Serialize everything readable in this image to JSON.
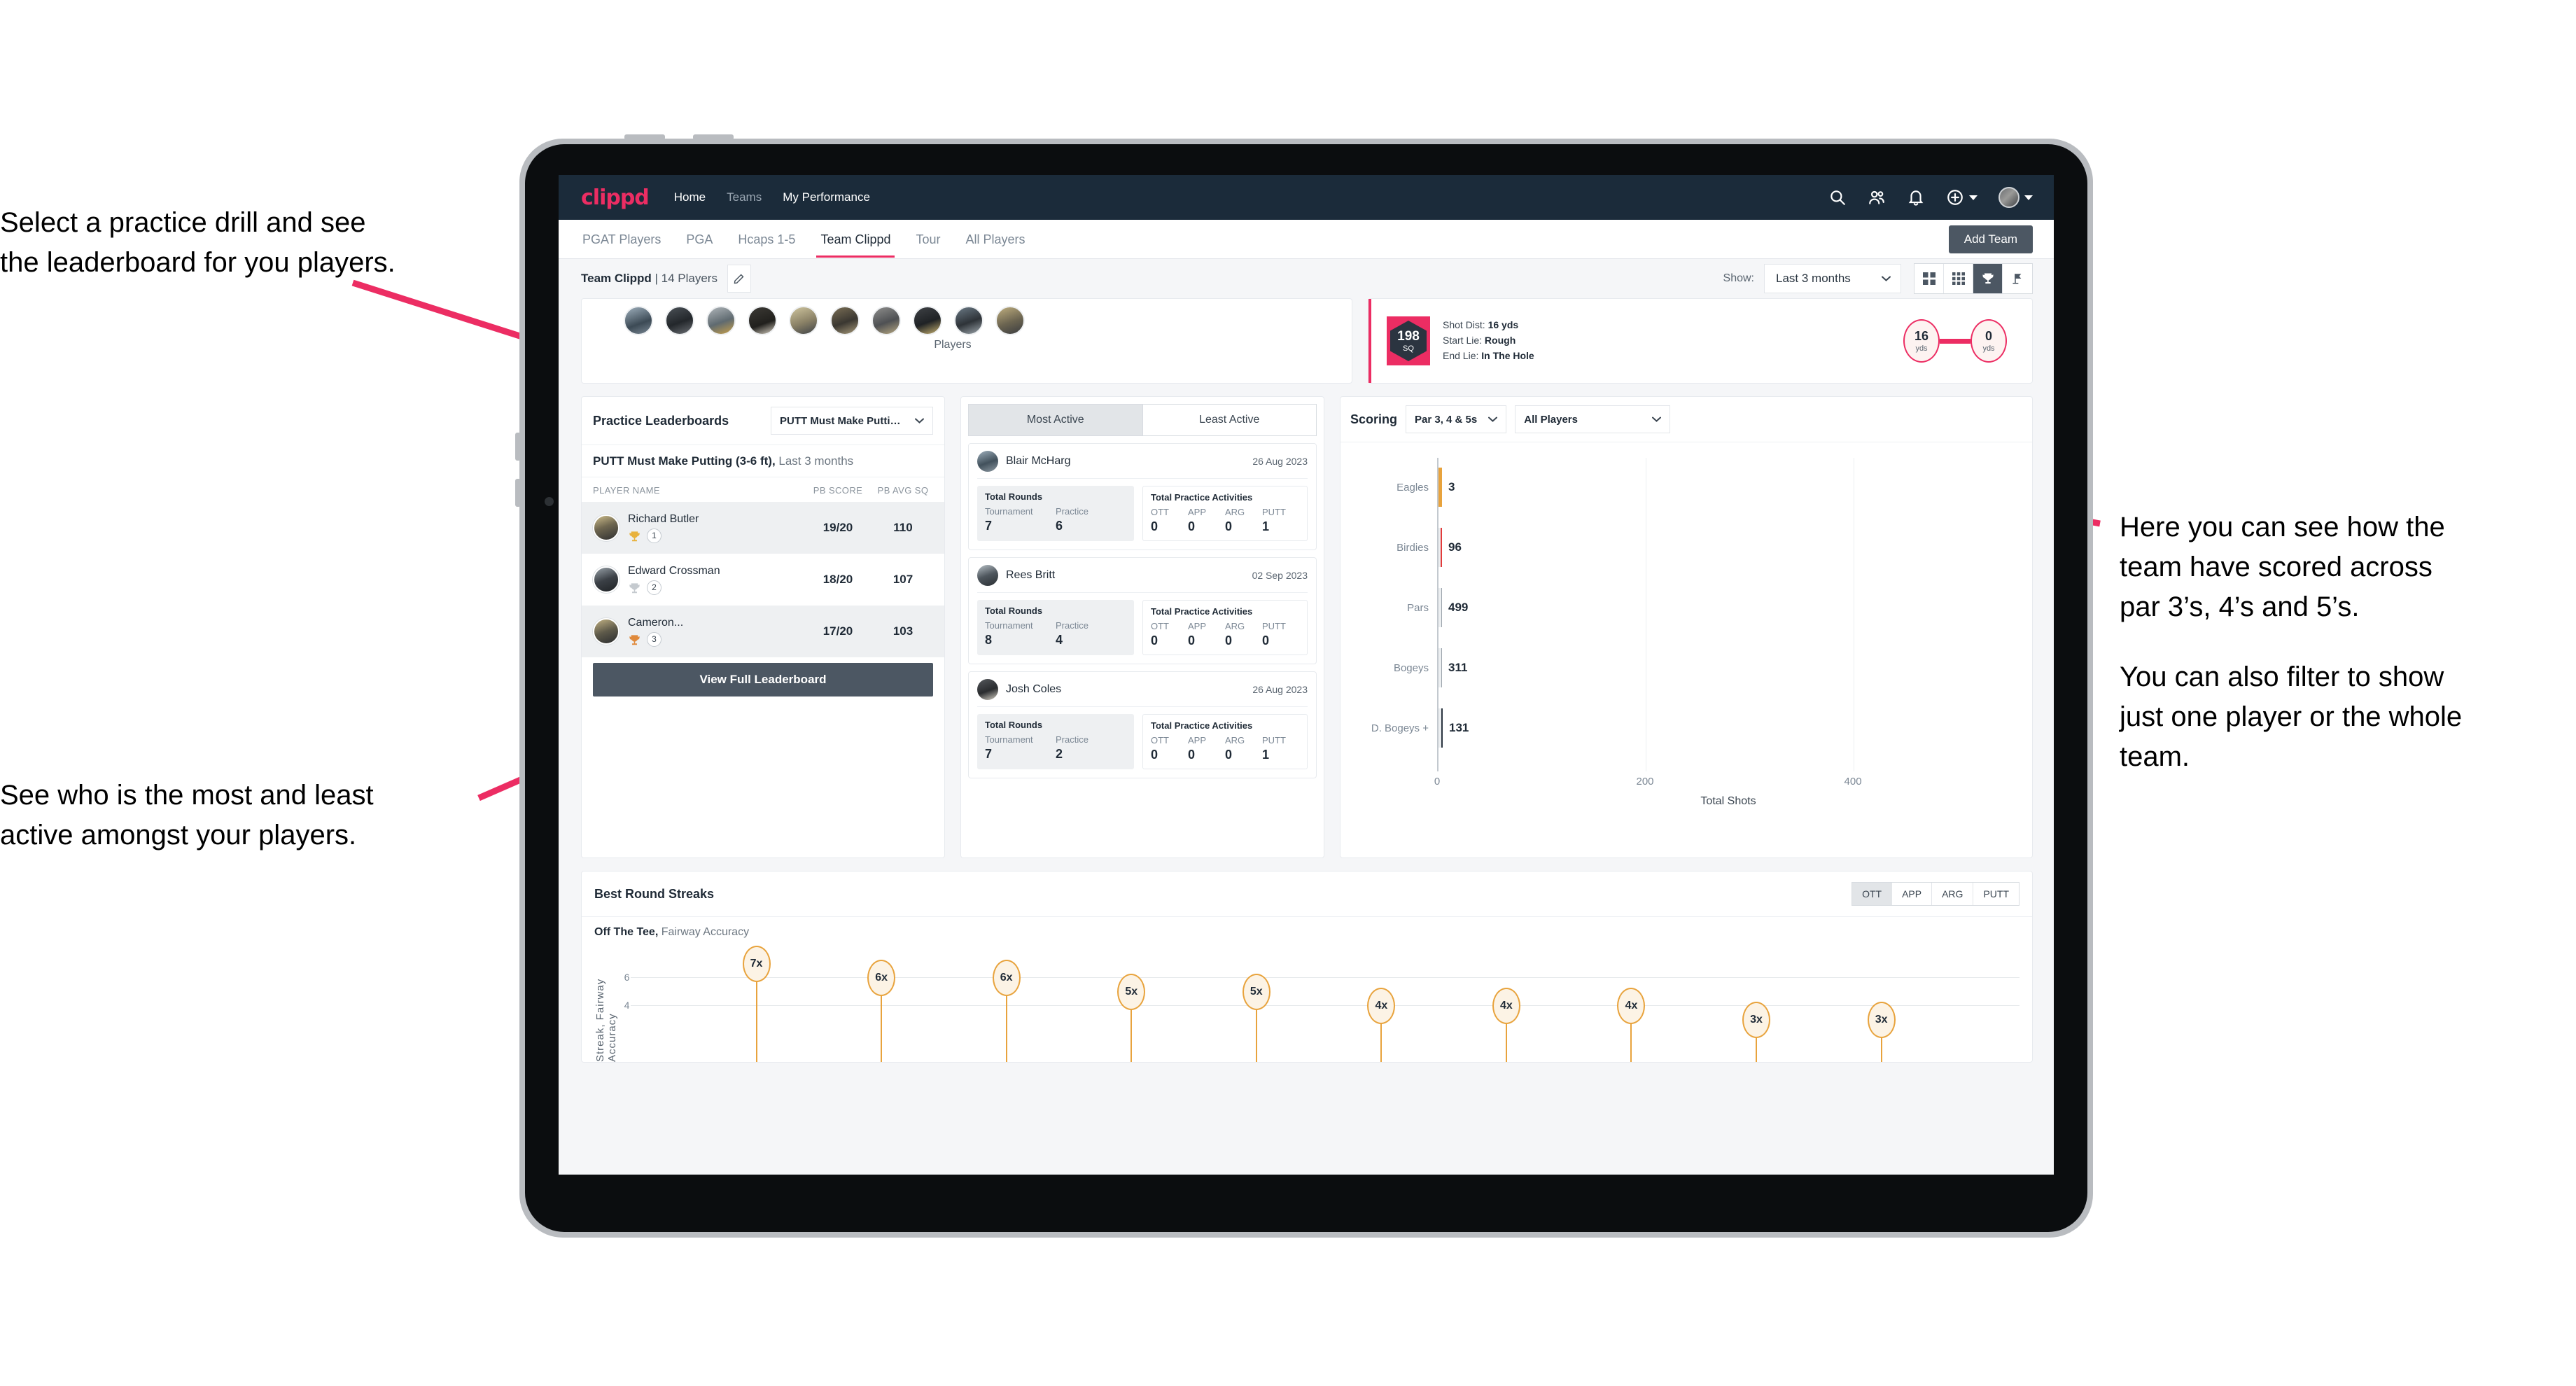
{
  "annotations": {
    "top_left": [
      "Select a practice drill and see",
      "the leaderboard for you players."
    ],
    "bottom_left": [
      "See who is the most and least",
      "active amongst your players."
    ],
    "right_p1": [
      "Here you can see how the",
      "team have scored across",
      "par 3’s, 4’s and 5’s."
    ],
    "right_p2": [
      "You can also filter to show",
      "just one player or the whole",
      "team."
    ]
  },
  "topnav": {
    "logo": "clippd",
    "links": [
      {
        "label": "Home",
        "dim": false
      },
      {
        "label": "Teams",
        "dim": true
      },
      {
        "label": "My Performance",
        "dim": false
      }
    ],
    "icons": [
      "search-icon",
      "people-icon",
      "bell-icon",
      "plus-circle-icon",
      "avatar"
    ]
  },
  "tabs": [
    {
      "label": "PGAT Players",
      "active": false
    },
    {
      "label": "PGA",
      "active": false
    },
    {
      "label": "Hcaps 1-5",
      "active": false
    },
    {
      "label": "Team Clippd",
      "active": true
    },
    {
      "label": "Tour",
      "active": false
    },
    {
      "label": "All Players",
      "active": false
    }
  ],
  "add_team_label": "Add Team",
  "toolbar": {
    "team_name": "Team Clippd",
    "team_players": "| 14 Players",
    "show_label": "Show:",
    "period_value": "Last 3 months",
    "view_toggles": [
      {
        "name": "grid-2x2-icon",
        "active": false
      },
      {
        "name": "grid-3x3-icon",
        "active": false
      },
      {
        "name": "trophy-icon",
        "active": true
      },
      {
        "name": "flag-icon",
        "active": false
      }
    ]
  },
  "players_card": {
    "caption": "Players",
    "avatar_count": 10
  },
  "shot_card": {
    "sq_value": "198",
    "sq_unit": "SQ",
    "lines": [
      {
        "key": "Shot Dist:",
        "value": "16 yds"
      },
      {
        "key": "Start Lie:",
        "value": "Rough"
      },
      {
        "key": "End Lie:",
        "value": "In The Hole"
      }
    ],
    "start_dist": "16",
    "start_unit": "yds",
    "end_dist": "0",
    "end_unit": "yds"
  },
  "leaderboard": {
    "title": "Practice Leaderboards",
    "drill_select": "PUTT Must Make Putting ...",
    "subtitle_bold": "PUTT Must Make Putting (3-6 ft),",
    "subtitle_light": " Last 3 months",
    "columns": [
      "PLAYER NAME",
      "PB SCORE",
      "PB AVG SQ"
    ],
    "rows": [
      {
        "name": "Richard Butler",
        "rank": "1",
        "medal": "gold",
        "pb_score": "19/20",
        "pb_avg_sq": "110"
      },
      {
        "name": "Edward Crossman",
        "rank": "2",
        "medal": "silver",
        "pb_score": "18/20",
        "pb_avg_sq": "107"
      },
      {
        "name": "Cameron...",
        "rank": "3",
        "medal": "bronze",
        "pb_score": "17/20",
        "pb_avg_sq": "103"
      }
    ],
    "button": "View Full Leaderboard"
  },
  "activity": {
    "tabs": [
      {
        "label": "Most Active",
        "active": true
      },
      {
        "label": "Least Active",
        "active": false
      }
    ],
    "rounds_title": "Total Rounds",
    "activities_title": "Total Practice Activities",
    "rounds_keys": [
      "Tournament",
      "Practice"
    ],
    "activity_keys": [
      "OTT",
      "APP",
      "ARG",
      "PUTT"
    ],
    "players": [
      {
        "name": "Blair McHarg",
        "date": "26 Aug 2023",
        "tournament": "7",
        "practice": "6",
        "ott": "0",
        "app": "0",
        "arg": "0",
        "putt": "1"
      },
      {
        "name": "Rees Britt",
        "date": "02 Sep 2023",
        "tournament": "8",
        "practice": "4",
        "ott": "0",
        "app": "0",
        "arg": "0",
        "putt": "0"
      },
      {
        "name": "Josh Coles",
        "date": "26 Aug 2023",
        "tournament": "7",
        "practice": "2",
        "ott": "0",
        "app": "0",
        "arg": "0",
        "putt": "1"
      }
    ]
  },
  "scoring": {
    "title": "Scoring",
    "par_filter": "Par 3, 4 & 5s",
    "player_filter": "All Players"
  },
  "streaks": {
    "title": "Best Round Streaks",
    "segments": [
      {
        "label": "OTT",
        "active": true
      },
      {
        "label": "APP",
        "active": false
      },
      {
        "label": "ARG",
        "active": false
      },
      {
        "label": "PUTT",
        "active": false
      }
    ],
    "sub_bold": "Off The Tee,",
    "sub_light": " Fairway Accuracy"
  },
  "chart_data": [
    {
      "type": "bar",
      "orientation": "horizontal",
      "title": "Scoring",
      "categories": [
        "Eagles",
        "Birdies",
        "Pars",
        "Bogeys",
        "D. Bogeys +"
      ],
      "values": [
        3,
        96,
        499,
        311,
        131
      ],
      "cap_colors": [
        "#e8a33d",
        "#e23b3b",
        "#9aa2ab",
        "#9aa2ab",
        "#2b3440"
      ],
      "xlabel": "Total Shots",
      "ylabel": "",
      "xticks": [
        0,
        200,
        400
      ],
      "xlim": [
        0,
        560
      ],
      "grid": true,
      "legend": "none"
    },
    {
      "type": "lollipop",
      "title": "Best Round Streaks",
      "subtitle": "Off The Tee, Fairway Accuracy",
      "ylabel": "Streak, Fairway Accuracy",
      "values": [
        7,
        6,
        6,
        5,
        5,
        4,
        4,
        4,
        3,
        3
      ],
      "labels": [
        "7x",
        "6x",
        "6x",
        "5x",
        "5x",
        "4x",
        "4x",
        "4x",
        "3x",
        "3x"
      ],
      "yticks": [
        4,
        6
      ],
      "ylim": [
        0,
        8
      ],
      "grid": true
    }
  ]
}
